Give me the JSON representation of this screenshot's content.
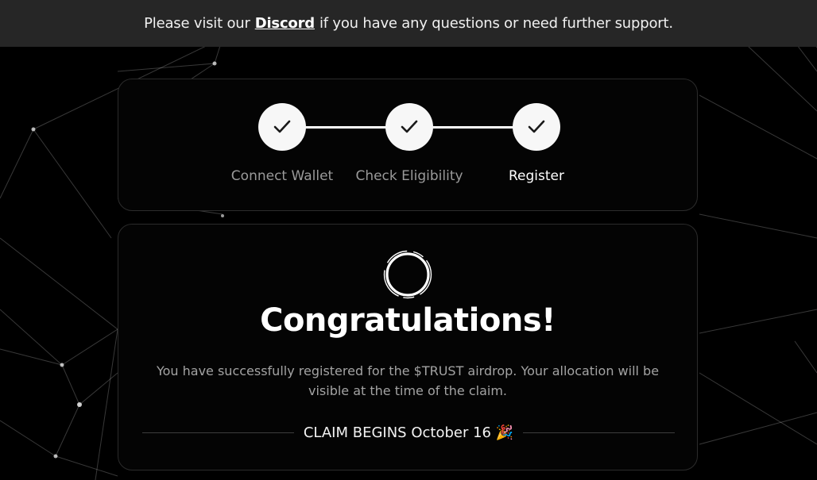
{
  "banner": {
    "text_before": "Please visit our",
    "link_label": "Discord",
    "text_after": "if you have any questions or need further support."
  },
  "steps": [
    {
      "label": "Connect Wallet",
      "status": "complete"
    },
    {
      "label": "Check Eligibility",
      "status": "complete"
    },
    {
      "label": "Register",
      "status": "complete"
    }
  ],
  "result": {
    "icon": "loading-ring-icon",
    "title": "Congratulations!",
    "message": "You have successfully registered for the $TRUST airdrop. Your allocation will be visible at the time of the claim.",
    "claim_text": "CLAIM BEGINS October 16 🎉"
  },
  "colors": {
    "background": "#000000",
    "banner_bg": "#262626",
    "card_bg": "#040404",
    "card_border": "#2b2b2b",
    "step_circle": "#f7f7f7",
    "muted_text": "#9a9a9a"
  }
}
